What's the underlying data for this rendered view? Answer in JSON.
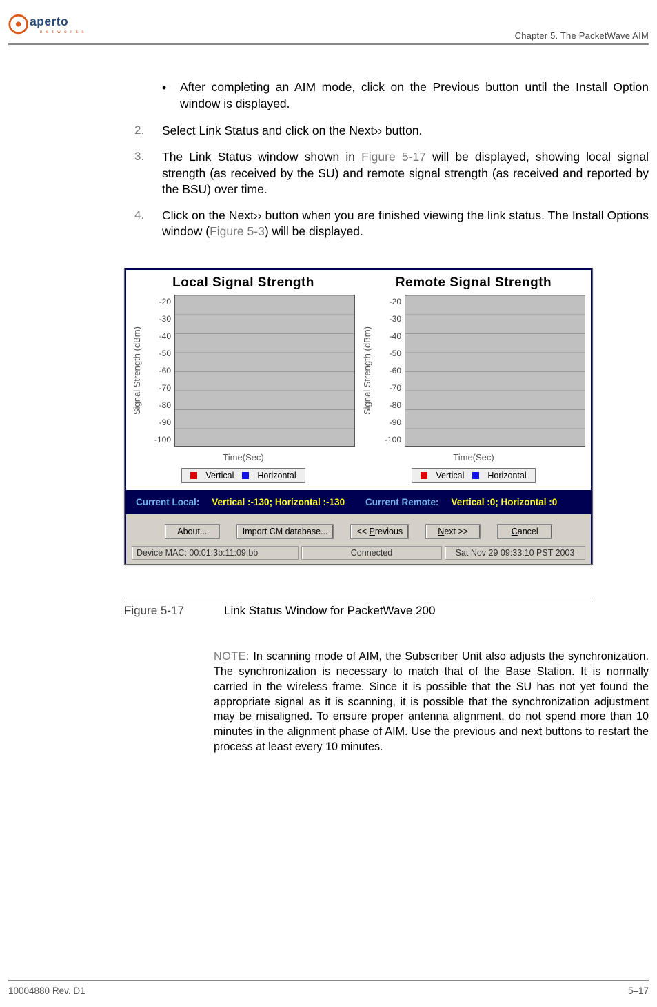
{
  "header": {
    "chapter": "Chapter 5.  The PacketWave AIM",
    "logo_text_top": "aperto",
    "logo_text_sub": "n e t w o r k s"
  },
  "body": {
    "bullet1": "After completing an AIM mode, click on the Previous button until the Install Option window is displayed.",
    "step2_num": "2.",
    "step2": "Select Link Status and click on the Next›› button.",
    "step3_num": "3.",
    "step3_a": "The Link Status window shown in ",
    "step3_fig": "Figure 5-17",
    "step3_b": " will be displayed, showing local signal strength (as received by the SU) and remote signal strength (as received and reported by the BSU) over time.",
    "step4_num": "4.",
    "step4_a": "Click on the Next›› button when you are finished viewing the link status. The Install Options window (",
    "step4_fig": "Figure 5-3",
    "step4_b": ") will be displayed."
  },
  "chart_data": [
    {
      "type": "line",
      "title": "Local Signal Strength",
      "ylabel": "Signal Strength (dBm)",
      "xlabel": "Time(Sec)",
      "ylim": [
        -100,
        -20
      ],
      "yticks": [
        -20,
        -30,
        -40,
        -50,
        -60,
        -70,
        -80,
        -90,
        -100
      ],
      "x": [],
      "series": [
        {
          "name": "Vertical",
          "color": "#cc0000",
          "values": []
        },
        {
          "name": "Horizontal",
          "color": "#1111dd",
          "values": []
        }
      ]
    },
    {
      "type": "line",
      "title": "Remote Signal Strength",
      "ylabel": "Signal Strength (dBm)",
      "xlabel": "Time(Sec)",
      "ylim": [
        -100,
        -20
      ],
      "yticks": [
        -20,
        -30,
        -40,
        -50,
        -60,
        -70,
        -80,
        -90,
        -100
      ],
      "x": [],
      "series": [
        {
          "name": "Vertical",
          "color": "#cc0000",
          "values": []
        },
        {
          "name": "Horizontal",
          "color": "#1111dd",
          "values": []
        }
      ]
    }
  ],
  "status": {
    "cl_label": "Current Local:",
    "cl_value": "Vertical :-130; Horizontal :-130",
    "cr_label": "Current Remote:",
    "cr_value": "Vertical :0; Horizontal :0"
  },
  "buttons": {
    "about": "About...",
    "import": "Import CM database...",
    "prev_pfx": "<< ",
    "prev_ul": "P",
    "prev_rest": "revious",
    "next_ul": "N",
    "next_rest": "ext >>",
    "cancel_ul": "C",
    "cancel_rest": "ancel"
  },
  "info": {
    "mac": "Device MAC: 00:01:3b:11:09:bb",
    "conn": "Connected",
    "time": "Sat Nov 29 09:33:10 PST 2003"
  },
  "figure": {
    "num": "Figure 5-17",
    "caption": "Link Status Window for PacketWave 200"
  },
  "note": {
    "lead": "NOTE:",
    "text": "  In scanning mode of AIM, the Subscriber Unit also adjusts the synchronization. The synchronization is necessary to match that of the Base Station. It is normally carried in the wireless frame. Since it is possible that the SU has not yet found the appropriate signal as it is scanning, it is possible that the synchronization adjustment may be misaligned. To ensure proper antenna alignment, do not spend more than 10 minutes in the alignment phase of AIM. Use the previous and next buttons to restart the process at least every 10 minutes."
  },
  "footer": {
    "left": "10004880 Rev. D1",
    "right": "5–17"
  }
}
